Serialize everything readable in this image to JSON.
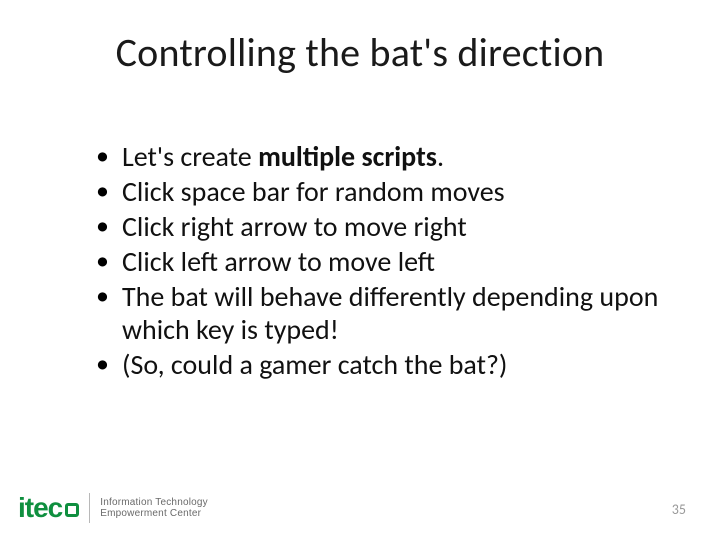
{
  "title": "Controlling the bat's direction",
  "bullets": [
    {
      "pre": "Let's create ",
      "bold": "multiple scripts",
      "post": "."
    },
    {
      "pre": "Click space bar for random moves",
      "bold": "",
      "post": ""
    },
    {
      "pre": "Click right arrow to move right",
      "bold": "",
      "post": ""
    },
    {
      "pre": "Click left arrow to move left",
      "bold": "",
      "post": ""
    },
    {
      "pre": "The bat will behave differently depending upon which key is typed!",
      "bold": "",
      "post": ""
    },
    {
      "pre": "(So, could a gamer catch the bat?)",
      "bold": "",
      "post": ""
    }
  ],
  "logo": {
    "mark": "itec",
    "line1": "Information Technology",
    "line2": "Empowerment Center"
  },
  "page_number": "35"
}
